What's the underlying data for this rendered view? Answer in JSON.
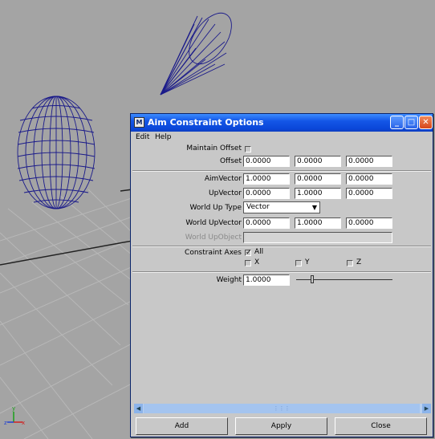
{
  "window": {
    "title": "Aim Constraint Options",
    "icon": "maya-app-icon",
    "controls": [
      "minimize-icon",
      "maximize-icon",
      "close-icon"
    ]
  },
  "menu": [
    "Edit",
    "Help"
  ],
  "form": {
    "maintain_offset_label": "Maintain Offset",
    "offset_label": "Offset",
    "offset_values": [
      "0.0000",
      "0.0000",
      "0.0000"
    ],
    "aim_vector_label": "AimVector",
    "aim_vector_values": [
      "1.0000",
      "0.0000",
      "0.0000"
    ],
    "up_vector_label": "UpVector",
    "up_vector_values": [
      "0.0000",
      "1.0000",
      "0.0000"
    ],
    "world_up_type_label": "World Up Type",
    "world_up_type_value": "Vector",
    "world_up_vector_label": "World UpVector",
    "world_up_vector_values": [
      "0.0000",
      "1.0000",
      "0.0000"
    ],
    "world_up_object_label": "World UpObject",
    "world_up_object_value": "",
    "constraint_axes_label": "Constraint Axes",
    "axes": {
      "all": "All",
      "x": "X",
      "y": "Y",
      "z": "Z"
    },
    "weight_label": "Weight",
    "weight_value": "1.0000",
    "weight_slider_level": 0.15
  },
  "buttons": {
    "add": "Add",
    "apply": "Apply",
    "close": "Close"
  },
  "viewport": {
    "background": "#a4a4a4",
    "wire_color": "#1a1a8a",
    "axis_labels": {
      "y": "y",
      "z": "z",
      "x": "x"
    }
  }
}
